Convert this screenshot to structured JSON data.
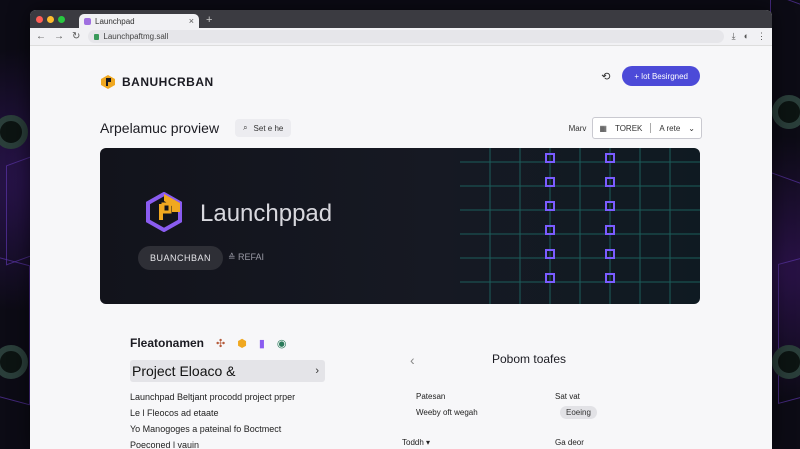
{
  "browser": {
    "tab_title": "Launchpad",
    "url": "Launchpaftmg.sall"
  },
  "header": {
    "brand": "BANUHCRBAN",
    "cta": "+ lot Besirgned"
  },
  "toolbar": {
    "page_title": "Arpelamuc proview",
    "search_label": "Set e he",
    "filter_label": "Marv",
    "select_left": "TOREK",
    "select_right": "A rete"
  },
  "hero": {
    "title": "Launchppad",
    "pill": "BUANCHBAN",
    "link": "≙ REFAI"
  },
  "left": {
    "section_title": "Fleatonamen",
    "project_title": "Project Eloaco &",
    "lines": [
      "Launchpad Beltjant procodd project prper",
      "Le l Fleocos ad etaate",
      "Yo Manogoges a pateinal fo Boctmect",
      "Poeconed l vauin"
    ]
  },
  "right": {
    "title": "Pobom toafes",
    "k1": "Patesan",
    "v1": "Sat vat",
    "k2": "Weeby oft wegah",
    "v2": "Eoeing",
    "select": "Toddh",
    "v3": "Ga deor"
  },
  "colors": {
    "accent": "#4c4ad8",
    "grid": "#7a5cff"
  }
}
